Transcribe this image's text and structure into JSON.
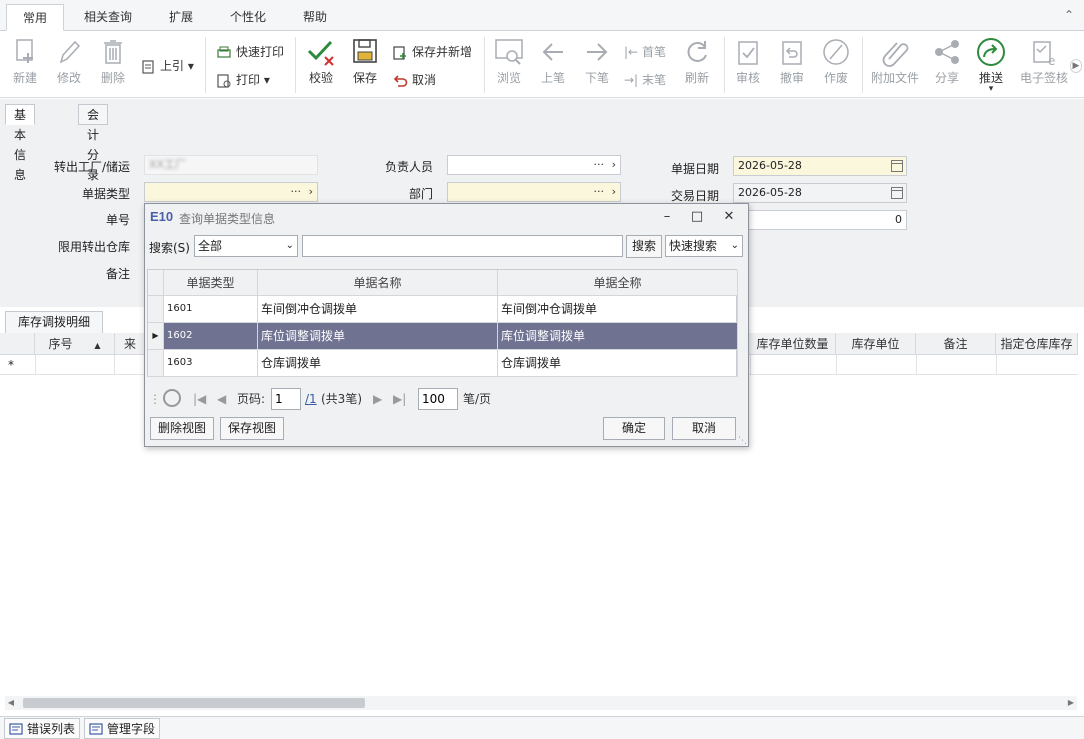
{
  "ribbon": {
    "tabs": [
      "常用",
      "相关查询",
      "扩展",
      "个性化",
      "帮助"
    ],
    "active_tab": "常用"
  },
  "toolbar": {
    "new": "新建",
    "edit": "修改",
    "delete": "删除",
    "reference": "上引",
    "quick_print": "快速打印",
    "print": "打印",
    "check": "校验",
    "save": "保存",
    "save_and_new": "保存并新增",
    "cancel": "取消",
    "browse": "浏览",
    "prev": "上笔",
    "next": "下笔",
    "first": "首笔",
    "last": "末笔",
    "refresh": "刷新",
    "approve": "审核",
    "unapprove": "撤审",
    "void": "作废",
    "attachment": "附加文件",
    "share": "分享",
    "push": "推送",
    "e_sign": "电子签核"
  },
  "form": {
    "tabs": [
      "基本信息",
      "会计分录"
    ],
    "active_tab": "基本信息",
    "labels": {
      "out_plant": "转出工厂/储运",
      "doc_type": "单据类型",
      "doc_no": "单号",
      "limit_out_wh": "限用转出仓库",
      "remark": "备注",
      "person": "负责人员",
      "dept": "部门",
      "doc_date": "单据日期",
      "trans_date": "交易日期"
    },
    "values": {
      "out_plant": "XX工厂",
      "doc_date": "2026-05-28",
      "trans_date": "2026-05-28",
      "number_field": "0"
    },
    "ellipsis": "···"
  },
  "detail": {
    "tab": "库存调拨明细",
    "columns": [
      "序号",
      "来",
      "库存单位数量",
      "库存单位",
      "备注",
      "指定仓库库存"
    ],
    "new_row_marker": "*"
  },
  "bottom_tabs": [
    "错误列表",
    "管理字段"
  ],
  "dialog": {
    "logo": "E10",
    "title": "查询单据类型信息",
    "search_label": "搜索(S)",
    "search_scope": "全部",
    "search_value": "",
    "search_button": "搜索",
    "quick_search": "快速搜索",
    "columns": [
      "单据类型",
      "单据名称",
      "单据全称"
    ],
    "rows": [
      {
        "type": "1601",
        "name": "车间倒冲仓调拨单",
        "full_name": "车间倒冲仓调拨单"
      },
      {
        "type": "1602",
        "name": "库位调整调拨单",
        "full_name": "库位调整调拨单"
      },
      {
        "type": "1603",
        "name": "仓库调拨单",
        "full_name": "仓库调拨单"
      }
    ],
    "selected_row": "1602",
    "pager": {
      "page_label": "页码:",
      "page": "1",
      "total_pages": "/1",
      "total_records": "(共3笔)",
      "page_size": "100",
      "per_page_label": "笔/页"
    },
    "delete_view": "删除视图",
    "save_view": "保存视图",
    "ok": "确定",
    "cancel": "取消"
  },
  "colors": {
    "selected_row": "#6f7391",
    "required_field": "#fbf7dc",
    "brand": "#4a5fa8",
    "push_icon": "#2e8b3e"
  }
}
